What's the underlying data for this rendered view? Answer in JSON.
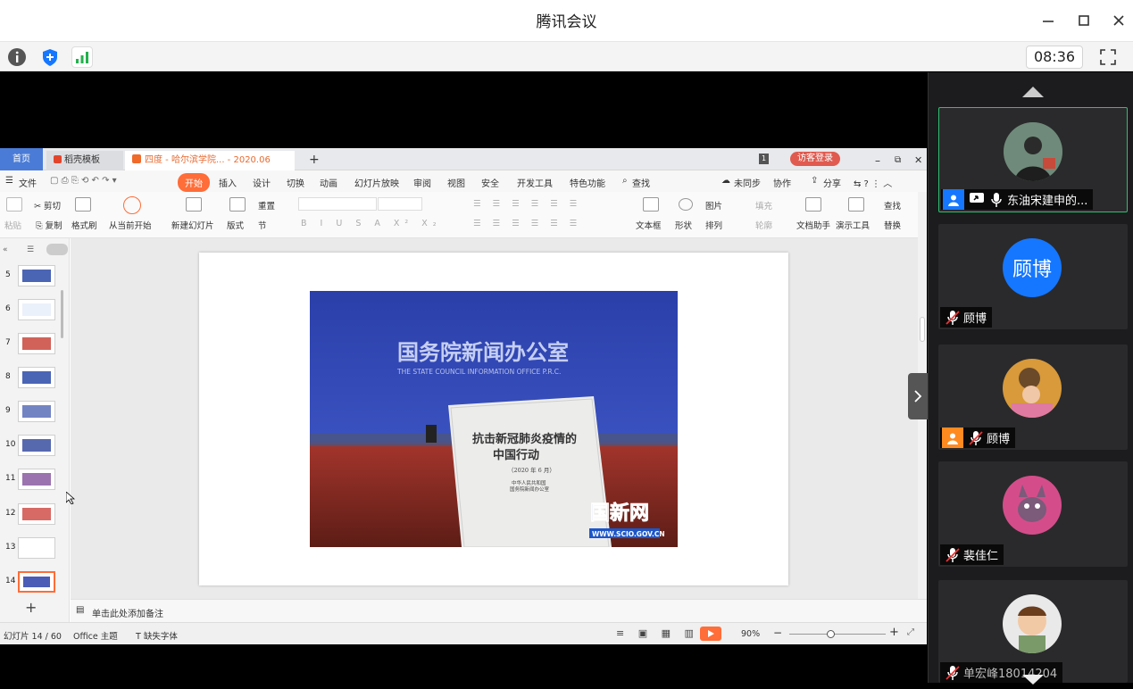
{
  "app": {
    "title": "腾讯会议",
    "timer": "08:36"
  },
  "wps": {
    "tabs": {
      "home": "首页",
      "template": "稻壳模板",
      "doc": "四度 - 哈尔滨学院... - 2020.06",
      "login": "访客登录"
    },
    "menu": [
      "文件",
      "开始",
      "插入",
      "设计",
      "切换",
      "动画",
      "幻灯片放映",
      "审阅",
      "视图",
      "安全",
      "开发工具",
      "特色功能",
      "查找"
    ],
    "menu_right": {
      "sync": "未同步",
      "collab": "协作",
      "share": "分享"
    },
    "ribbon": {
      "paste": "粘贴",
      "cut": "剪切",
      "copy": "复制",
      "format_painter": "格式刷",
      "from_current": "从当前开始",
      "new_slide": "新建幻灯片",
      "layout": "版式",
      "reset": "重置",
      "section": "节",
      "textbox": "文本框",
      "shape": "形状",
      "picture": "图片",
      "fill": "填充",
      "arrange": "排列",
      "outline": "轮廓",
      "doc_helper": "文档助手",
      "present_tools": "演示工具",
      "find": "查找",
      "replace": "替换"
    },
    "thumb_numbers": [
      "5",
      "6",
      "7",
      "8",
      "9",
      "10",
      "11",
      "12",
      "13",
      "14"
    ],
    "notes_placeholder": "单击此处添加备注",
    "status": {
      "slide_count": "幻灯片 14 / 60",
      "theme": "Office 主题",
      "missing_font": "缺失字体",
      "zoom": "90%"
    },
    "slide": {
      "banner_cn": "国务院新闻办公室",
      "banner_en": "THE STATE COUNCIL INFORMATION OFFICE P.R.C.",
      "book_title_1": "抗击新冠肺炎疫情的",
      "book_title_2": "中国行动",
      "book_date": "（2020 年 6 月）",
      "book_pub_1": "中华人民共和国",
      "book_pub_2": "国务院新闻办公室",
      "watermark": "国新网",
      "watermark_url": "WWW.SCIO.GOV.CN"
    }
  },
  "participants": [
    {
      "name": "东油宋建申的...",
      "active": true
    },
    {
      "name": "顾博",
      "avatar_text": "顾博"
    },
    {
      "name": "顾博"
    },
    {
      "name": "裴佳仁"
    },
    {
      "name": "单宏峰18014204"
    }
  ],
  "colors": {
    "accent_blue": "#1577ff",
    "active_border": "#2fbf71",
    "wps_orange": "#ff6d38",
    "photo_blue": "#2b3fa9"
  }
}
